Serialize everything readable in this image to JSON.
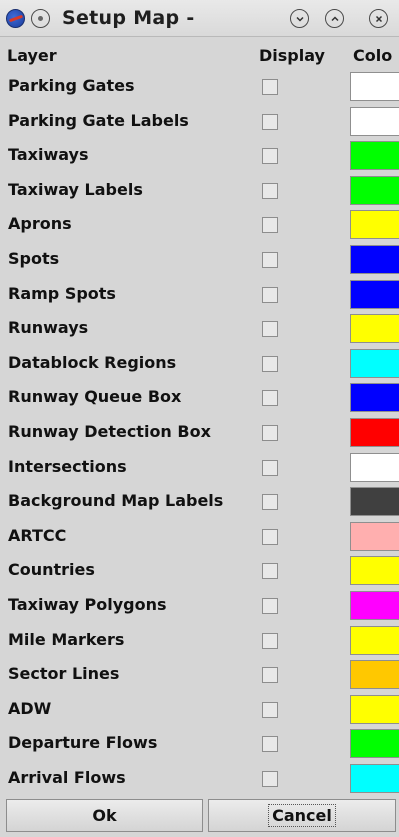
{
  "window": {
    "title": "Setup Map -"
  },
  "columns": {
    "layer": "Layer",
    "display": "Display",
    "color": "Colo"
  },
  "layers": [
    {
      "label": "Parking Gates",
      "color": "#ffffff"
    },
    {
      "label": "Parking Gate Labels",
      "color": "#ffffff"
    },
    {
      "label": "Taxiways",
      "color": "#00ff00"
    },
    {
      "label": "Taxiway Labels",
      "color": "#00ff00"
    },
    {
      "label": "Aprons",
      "color": "#ffff00"
    },
    {
      "label": "Spots",
      "color": "#0000ff"
    },
    {
      "label": "Ramp Spots",
      "color": "#0000ff"
    },
    {
      "label": "Runways",
      "color": "#ffff00"
    },
    {
      "label": "Datablock Regions",
      "color": "#00ffff"
    },
    {
      "label": "Runway Queue Box",
      "color": "#0000ff"
    },
    {
      "label": "Runway Detection Box",
      "color": "#ff0000"
    },
    {
      "label": "Intersections",
      "color": "#ffffff"
    },
    {
      "label": "Background Map Labels",
      "color": "#404040"
    },
    {
      "label": "ARTCC",
      "color": "#ffafaf"
    },
    {
      "label": "Countries",
      "color": "#ffff00"
    },
    {
      "label": "Taxiway Polygons",
      "color": "#ff00ff"
    },
    {
      "label": "Mile Markers",
      "color": "#ffff00"
    },
    {
      "label": "Sector Lines",
      "color": "#ffc800"
    },
    {
      "label": "ADW",
      "color": "#ffff00"
    },
    {
      "label": "Departure Flows",
      "color": "#00ff00"
    },
    {
      "label": "Arrival Flows",
      "color": "#00ffff"
    }
  ],
  "buttons": {
    "ok": "Ok",
    "cancel": "Cancel"
  }
}
